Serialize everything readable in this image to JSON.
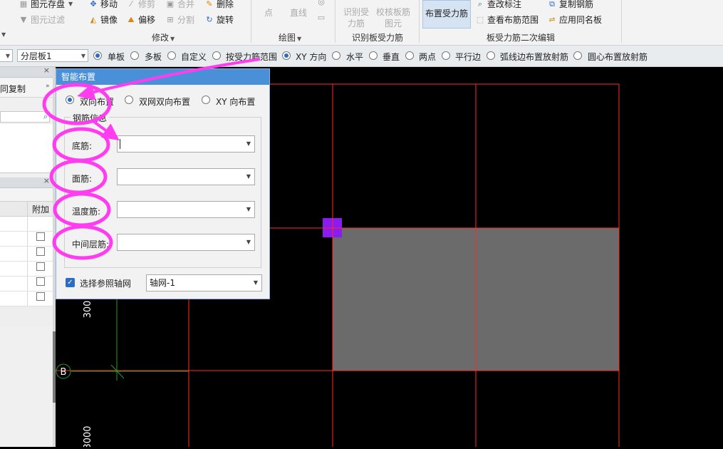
{
  "ribbon": {
    "modify_group": {
      "label": "修改",
      "items": [
        "移动",
        "修剪",
        "合并",
        "删除",
        "镜像",
        "偏移",
        "分割",
        "旋转"
      ],
      "top_left_items": [
        "图元存盘",
        "图元过滤"
      ]
    },
    "draw_group": {
      "label": "绘图",
      "items": [
        "点",
        "直线"
      ]
    },
    "identify_group": {
      "label": "识别板受力筋",
      "items": [
        "识别受力筋",
        "校核板筋图元"
      ]
    },
    "layout_group": {
      "label": "板受力筋二次编辑",
      "main_button": "布置受力筋",
      "items": [
        "查改标注",
        "复制钢筋",
        "查看布筋范围",
        "应用同名板"
      ]
    }
  },
  "toolbar": {
    "layer_combo": "分层板1",
    "options": [
      {
        "label": "单板",
        "selected": true
      },
      {
        "label": "多板",
        "selected": false
      },
      {
        "label": "自定义",
        "selected": false
      },
      {
        "label": "按受力筋范围",
        "selected": false
      },
      {
        "label": "XY 方向",
        "selected": true
      },
      {
        "label": "水平",
        "selected": false
      },
      {
        "label": "垂直",
        "selected": false
      },
      {
        "label": "两点",
        "selected": false
      },
      {
        "label": "平行边",
        "selected": false
      },
      {
        "label": "弧线边布置放射筋",
        "selected": false
      },
      {
        "label": "圆心布置放射筋",
        "selected": false
      }
    ]
  },
  "left_panel": {
    "copy_label": "同复制",
    "column_header": "附加"
  },
  "dialog": {
    "title": "智能布置",
    "radio_options": [
      {
        "label": "双向布置",
        "selected": true
      },
      {
        "label": "双网双向布置",
        "selected": false
      },
      {
        "label": "XY 向布置",
        "selected": false
      }
    ],
    "group_label": "钢筋信息",
    "fields": [
      {
        "label": "底筋:",
        "value": ""
      },
      {
        "label": "面筋:",
        "value": ""
      },
      {
        "label": "温度筋:",
        "value": ""
      },
      {
        "label": "中间层筋:",
        "value": ""
      }
    ],
    "ref_axis_checkbox": {
      "label": "选择参照轴网",
      "checked": true
    },
    "ref_axis_value": "轴网-1"
  },
  "canvas": {
    "axis_label_b": "B",
    "dim_label_1": "300",
    "dim_label_2": "3000"
  },
  "colors": {
    "annotation": "#ff3cf0",
    "grid_red": "#ff2a2a",
    "selected_slab": "#6b6b6b",
    "marker": "#8a1cf0",
    "axis_green": "#2a9a2a"
  }
}
